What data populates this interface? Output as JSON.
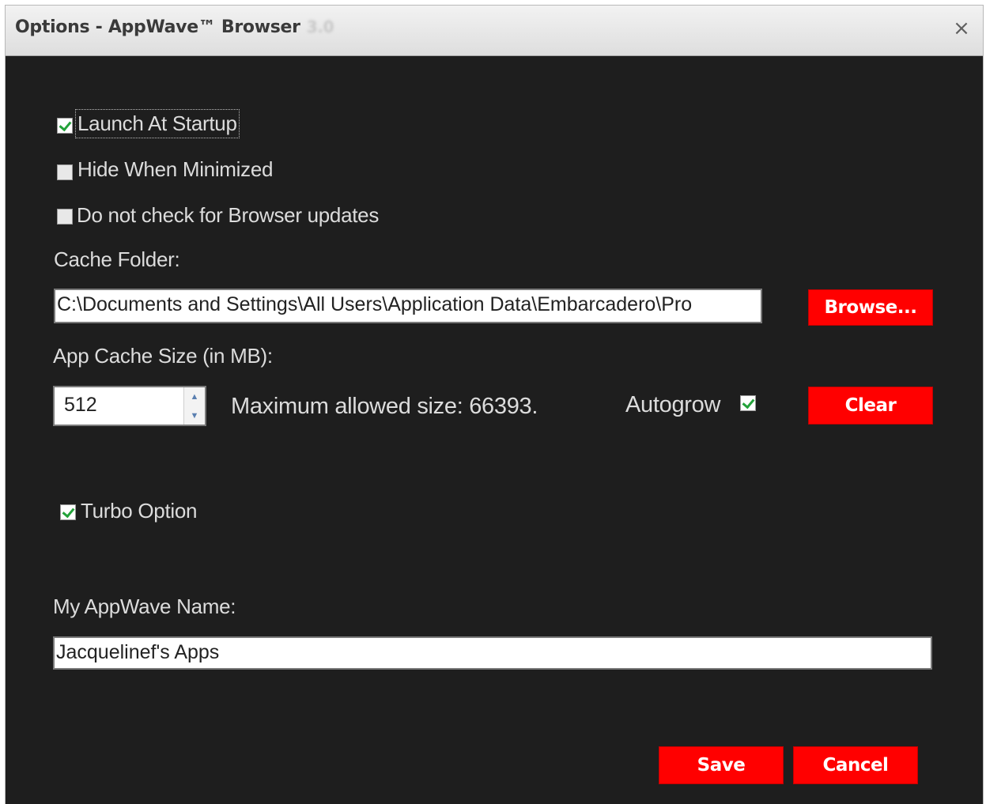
{
  "window": {
    "title": "Options - AppWave™ Browser",
    "version": "3.0",
    "close_glyph": "×"
  },
  "options": {
    "launch_at_startup": {
      "label": "Launch At Startup",
      "checked": true
    },
    "hide_when_minimized": {
      "label": "Hide When Minimized",
      "checked": false
    },
    "no_update_check": {
      "label": "Do not check for Browser updates",
      "checked": false
    }
  },
  "cache_folder": {
    "label": "Cache Folder:",
    "value": "C:\\Documents and Settings\\All Users\\Application Data\\Embarcadero\\Pro",
    "browse_label": "Browse..."
  },
  "cache_size": {
    "label": "App Cache Size (in MB):",
    "value": "512",
    "max_text": "Maximum allowed size: 66393.",
    "autogrow_label": "Autogrow",
    "autogrow_checked": true,
    "clear_label": "Clear"
  },
  "turbo": {
    "label": "Turbo Option",
    "checked": true
  },
  "name": {
    "label": "My AppWave Name:",
    "value": "Jacquelinef's Apps"
  },
  "footer": {
    "save_label": "Save",
    "cancel_label": "Cancel"
  },
  "colors": {
    "accent": "#ff0000",
    "background": "#1e1e1e",
    "text": "#dcdcdc",
    "check": "#23a23a"
  },
  "icons": {
    "close": "close-icon",
    "spin_up": "chevron-up-icon",
    "spin_down": "chevron-down-icon",
    "check": "checkmark-icon"
  }
}
